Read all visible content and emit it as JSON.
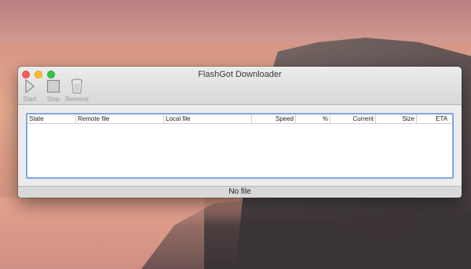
{
  "window": {
    "title": "FlashGot Downloader"
  },
  "toolbar": {
    "start_label": "Start",
    "stop_label": "Stop",
    "remove_label": "Remove"
  },
  "table": {
    "columns": [
      "State",
      "Remote file",
      "Local file",
      "Speed",
      "%",
      "Current",
      "Size",
      "ETA"
    ],
    "rows": []
  },
  "status": {
    "text": "No file"
  },
  "colors": {
    "selection_border": "#7ea7e3",
    "close": "#fc5f57",
    "minimize": "#fdbc2e",
    "zoom": "#33c748"
  },
  "icons": {
    "start": "play-icon",
    "stop": "stop-icon",
    "remove": "trash-icon"
  }
}
